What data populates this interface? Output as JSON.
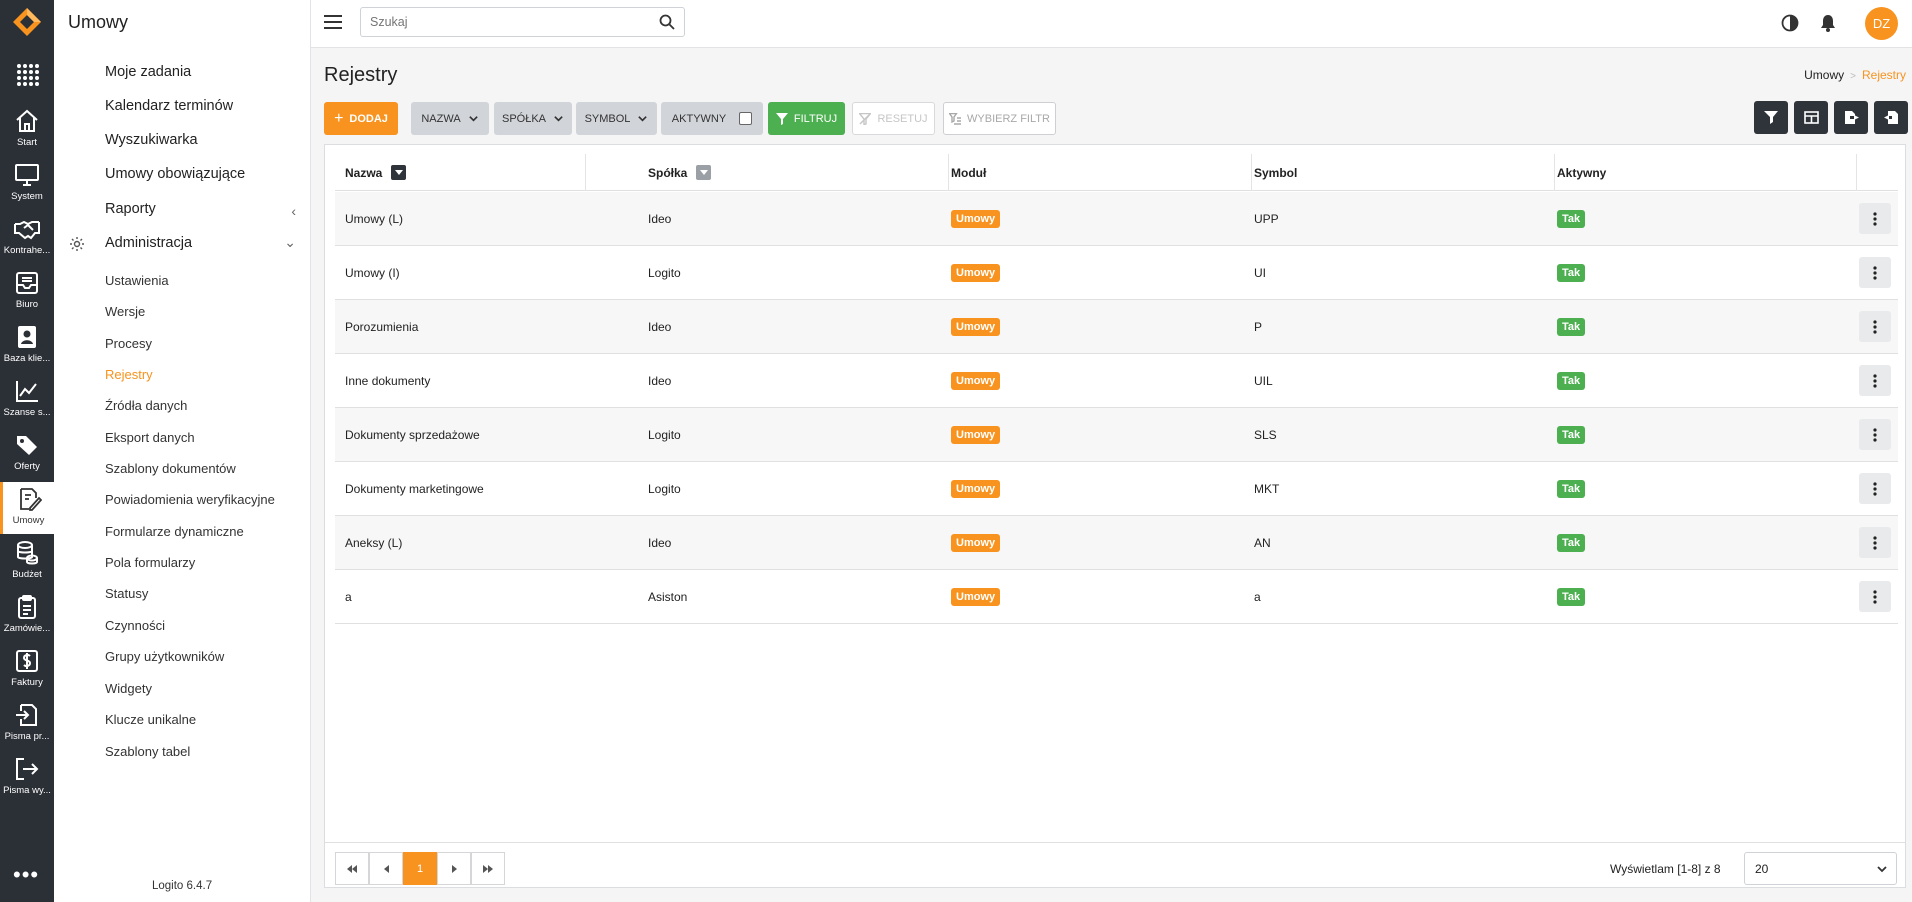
{
  "rail": {
    "items": [
      {
        "label": "Start",
        "icon": "home-icon"
      },
      {
        "label": "System",
        "icon": "monitor-icon"
      },
      {
        "label": "Kontrahe...",
        "icon": "handshake-icon"
      },
      {
        "label": "Biuro",
        "icon": "inbox-icon"
      },
      {
        "label": "Baza klie...",
        "icon": "contacts-icon"
      },
      {
        "label": "Szanse s...",
        "icon": "chart-line-icon"
      },
      {
        "label": "Oferty",
        "icon": "tags-icon"
      },
      {
        "label": "Umowy",
        "icon": "contract-icon"
      },
      {
        "label": "Budżet",
        "icon": "coins-icon"
      },
      {
        "label": "Zamówie...",
        "icon": "clipboard-icon"
      },
      {
        "label": "Faktury",
        "icon": "invoice-icon"
      },
      {
        "label": "Pisma pr...",
        "icon": "sign-in-icon"
      },
      {
        "label": "Pisma wy...",
        "icon": "sign-out-icon"
      }
    ],
    "more": "•••"
  },
  "menu": {
    "title": "Umowy",
    "main": [
      {
        "label": "Moje zadania"
      },
      {
        "label": "Kalendarz terminów"
      },
      {
        "label": "Wyszukiwarka"
      },
      {
        "label": "Umowy obowiązujące"
      },
      {
        "label": "Raporty",
        "chevron": "‹"
      },
      {
        "label": "Administracja",
        "chevron": "⌄"
      }
    ],
    "sub": [
      "Ustawienia",
      "Wersje",
      "Procesy",
      "Rejestry",
      "Źródła danych",
      "Eksport danych",
      "Szablony dokumentów",
      "Powiadomienia weryfikacyjne",
      "Formularze dynamiczne",
      "Pola formularzy",
      "Statusy",
      "Czynności",
      "Grupy użytkowników",
      "Widgety",
      "Klucze unikalne",
      "Szablony tabel"
    ],
    "active_sub": "Rejestry",
    "version": "Logito 6.4.7"
  },
  "topbar": {
    "search_placeholder": "Szukaj",
    "avatar": "DZ"
  },
  "page": {
    "title": "Rejestry",
    "breadcrumb": [
      "Umowy",
      "Rejestry"
    ]
  },
  "toolbar": {
    "add": "DODAJ",
    "filters": [
      "NAZWA",
      "SPÓŁKA",
      "SYMBOL"
    ],
    "active_filter": "AKTYWNY",
    "filter": "FILTRUJ",
    "reset": "RESETUJ",
    "choose": "WYBIERZ FILTR"
  },
  "table": {
    "columns": [
      "Nazwa",
      "Spółka",
      "Moduł",
      "Symbol",
      "Aktywny"
    ],
    "rows": [
      {
        "nazwa": "Umowy (L)",
        "spolka": "Ideo",
        "modul": "Umowy",
        "symbol": "UPP",
        "aktywny": "Tak"
      },
      {
        "nazwa": "Umowy (I)",
        "spolka": "Logito",
        "modul": "Umowy",
        "symbol": "UI",
        "aktywny": "Tak"
      },
      {
        "nazwa": "Porozumienia",
        "spolka": "Ideo",
        "modul": "Umowy",
        "symbol": "P",
        "aktywny": "Tak"
      },
      {
        "nazwa": "Inne dokumenty",
        "spolka": "Ideo",
        "modul": "Umowy",
        "symbol": "UIL",
        "aktywny": "Tak"
      },
      {
        "nazwa": "Dokumenty sprzedażowe",
        "spolka": "Logito",
        "modul": "Umowy",
        "symbol": "SLS",
        "aktywny": "Tak"
      },
      {
        "nazwa": "Dokumenty marketingowe",
        "spolka": "Logito",
        "modul": "Umowy",
        "symbol": "MKT",
        "aktywny": "Tak"
      },
      {
        "nazwa": "Aneksy (L)",
        "spolka": "Ideo",
        "modul": "Umowy",
        "symbol": "AN",
        "aktywny": "Tak"
      },
      {
        "nazwa": "a",
        "spolka": "Asiston",
        "modul": "Umowy",
        "symbol": "a",
        "aktywny": "Tak"
      }
    ]
  },
  "pager": {
    "current_page": "1",
    "info": "Wyświetlam [1-8] z 8",
    "page_size": "20"
  },
  "colors": {
    "accent": "#f7931e",
    "success": "#4caf50",
    "rail_bg": "#2b2f36"
  }
}
